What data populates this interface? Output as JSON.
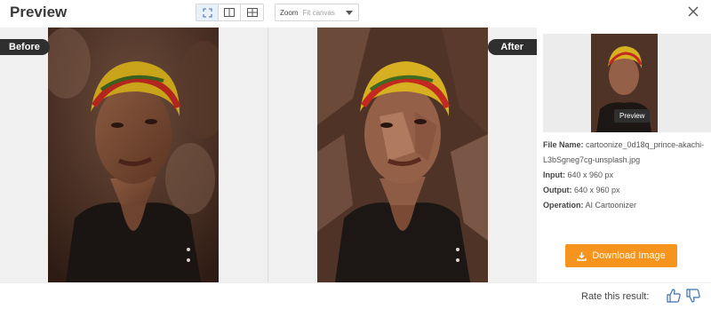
{
  "header": {
    "title": "Preview",
    "view_modes": [
      {
        "icon": "fit-screen-icon"
      },
      {
        "icon": "split-view-icon"
      },
      {
        "icon": "grid-view-icon"
      }
    ],
    "zoom": {
      "label": "Zoom",
      "value": "Fit canvas"
    },
    "close_icon": "close-icon"
  },
  "compare": {
    "before_label": "Before",
    "after_label": "After"
  },
  "sidebar": {
    "preview_button": "Preview",
    "file_name_label": "File Name:",
    "file_name": "cartoonize_0d18q_prince-akachi-L3bSgneg7cg-unsplash.jpg",
    "input_label": "Input:",
    "input_value": "640 x 960 px",
    "output_label": "Output:",
    "output_value": "640 x 960 px",
    "operation_label": "Operation:",
    "operation_value": "AI Cartoonizer",
    "download_label": "Download Image"
  },
  "footer": {
    "rate_label": "Rate this result:"
  },
  "colors": {
    "accent": "#f7941d",
    "tag_bg": "#2f2f2f",
    "canvas_bg": "#ececec"
  }
}
